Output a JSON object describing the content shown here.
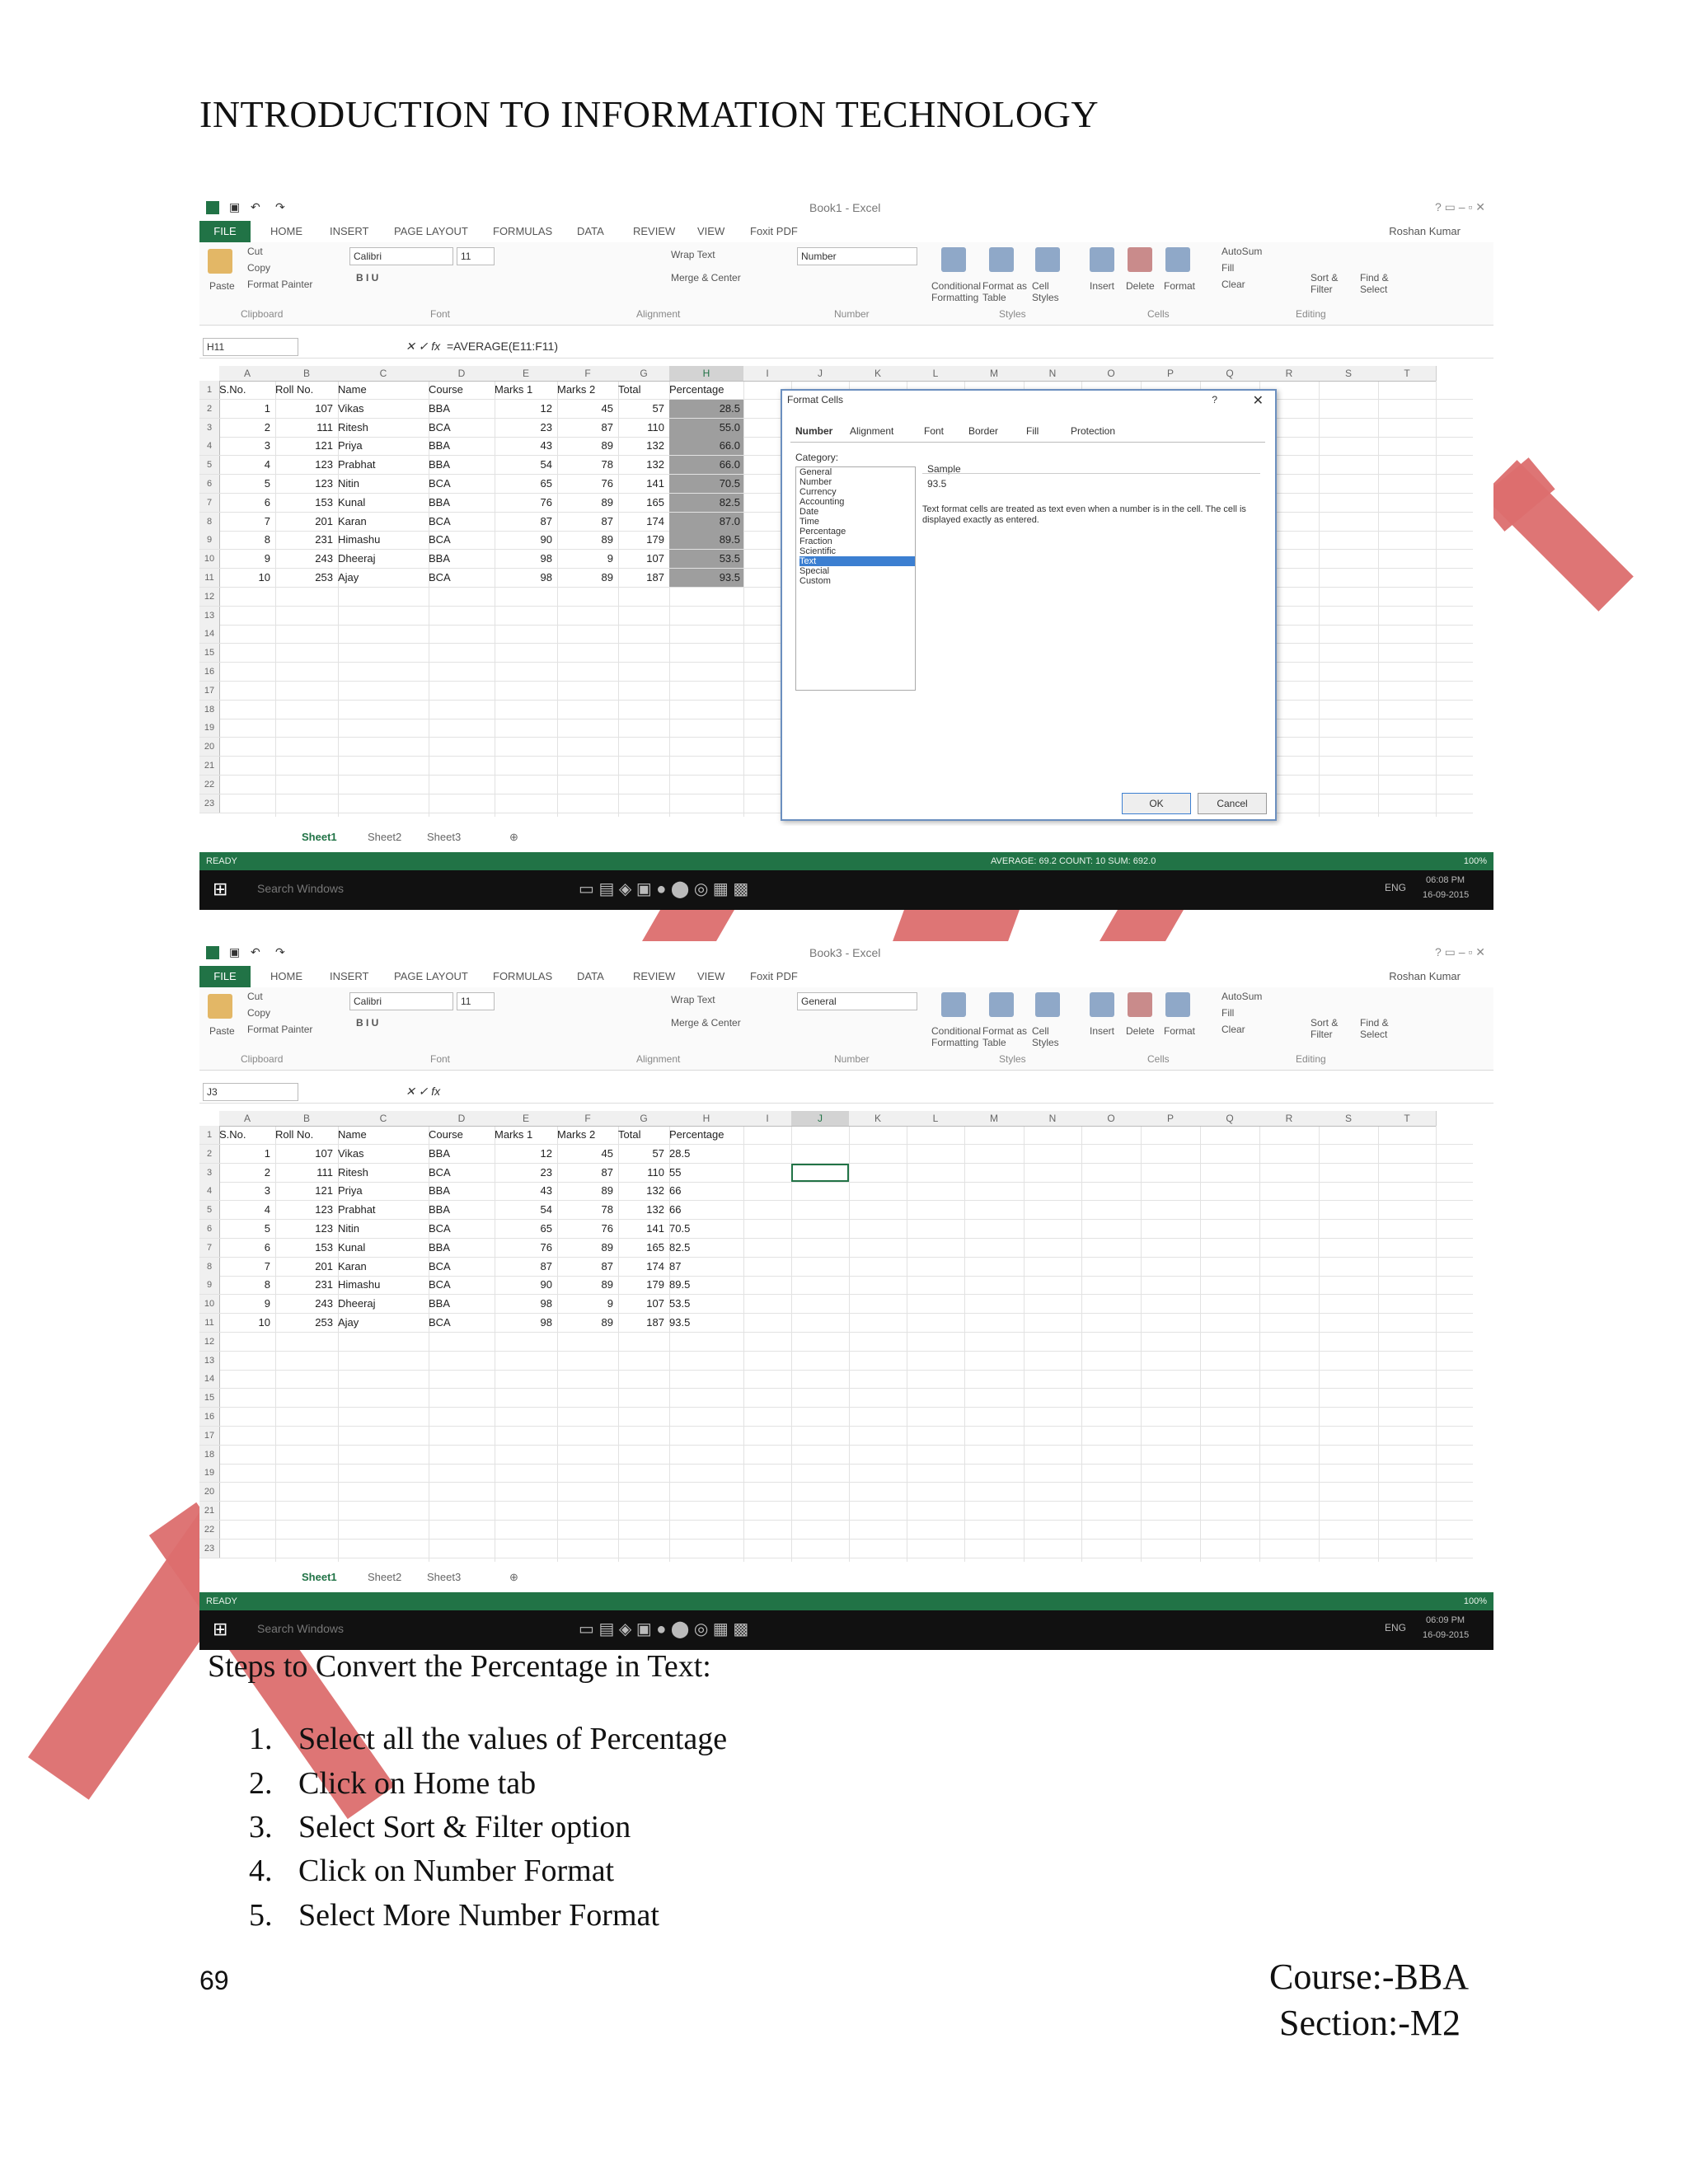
{
  "header": {
    "title": "INTRODUCTION TO INFORMATION TECHNOLOGY"
  },
  "excel": {
    "window_title_1": "Book1 - Excel",
    "window_title_2": "Book3 - Excel",
    "user": "Roshan Kumar",
    "tabs": [
      "FILE",
      "HOME",
      "INSERT",
      "PAGE LAYOUT",
      "FORMULAS",
      "DATA",
      "REVIEW",
      "VIEW",
      "Foxit PDF"
    ],
    "ribbon": {
      "cut": "Cut",
      "copy": "Copy",
      "format_painter": "Format Painter",
      "paste": "Paste",
      "font_name": "Calibri",
      "font_size": "11",
      "wrap_text": "Wrap Text",
      "merge_center": "Merge & Center",
      "number_format_1": "Number",
      "number_format_2": "General",
      "conditional_formatting": "Conditional Formatting",
      "format_as_table": "Format as Table",
      "cell_styles": "Cell Styles",
      "insert": "Insert",
      "delete": "Delete",
      "format": "Format",
      "autosum": "AutoSum",
      "fill": "Fill",
      "clear": "Clear",
      "sort_filter": "Sort & Filter",
      "find_select": "Find & Select",
      "groups": [
        "Clipboard",
        "Font",
        "Alignment",
        "Number",
        "Styles",
        "Cells",
        "Editing"
      ]
    },
    "name_box_1": "H11",
    "formula_1": "=AVERAGE(E11:F11)",
    "name_box_2": "J3",
    "formula_2": "",
    "columns": [
      "A",
      "B",
      "C",
      "D",
      "E",
      "F",
      "G",
      "H",
      "I",
      "J",
      "K",
      "L",
      "M",
      "N",
      "O",
      "P",
      "Q",
      "R",
      "S",
      "T"
    ],
    "table_headers": [
      "S.No.",
      "Roll No.",
      "Name",
      "Course",
      "Marks 1",
      "Marks 2",
      "Total",
      "Percentage"
    ],
    "table_rows": [
      [
        "1",
        "107",
        "Vikas",
        "BBA",
        "12",
        "45",
        "57",
        "28.5"
      ],
      [
        "2",
        "111",
        "Ritesh",
        "BCA",
        "23",
        "87",
        "110",
        "55"
      ],
      [
        "3",
        "121",
        "Priya",
        "BBA",
        "43",
        "89",
        "132",
        "66"
      ],
      [
        "4",
        "123",
        "Prabhat",
        "BBA",
        "54",
        "78",
        "132",
        "66"
      ],
      [
        "5",
        "123",
        "Nitin",
        "BCA",
        "65",
        "76",
        "141",
        "70.5"
      ],
      [
        "6",
        "153",
        "Kunal",
        "BBA",
        "76",
        "89",
        "165",
        "82.5"
      ],
      [
        "7",
        "201",
        "Karan",
        "BCA",
        "87",
        "87",
        "174",
        "87"
      ],
      [
        "8",
        "231",
        "Himashu",
        "BCA",
        "90",
        "89",
        "179",
        "89.5"
      ],
      [
        "9",
        "243",
        "Dheeraj",
        "BBA",
        "98",
        "9",
        "107",
        "53.5"
      ],
      [
        "10",
        "253",
        "Ajay",
        "BCA",
        "98",
        "89",
        "187",
        "93.5"
      ]
    ],
    "percentage_display_1": [
      "28.5",
      "55.0",
      "66.0",
      "66.0",
      "70.5",
      "82.5",
      "87.0",
      "89.5",
      "53.5",
      "93.5"
    ],
    "row_numbers": [
      "1",
      "2",
      "3",
      "4",
      "5",
      "6",
      "7",
      "8",
      "9",
      "10",
      "11",
      "12",
      "13",
      "14",
      "15",
      "16",
      "17",
      "18",
      "19",
      "20",
      "21",
      "22",
      "23"
    ],
    "sheets": [
      "Sheet1",
      "Sheet2",
      "Sheet3"
    ],
    "status_ready": "READY",
    "status_stats": "AVERAGE: 69.2    COUNT: 10    SUM: 692.0",
    "zoom": "100%",
    "taskbar_search": "Search Windows",
    "taskbar_lang": "ENG",
    "time_1": "06:08 PM",
    "date_1": "16-09-2015",
    "time_2": "06:09 PM",
    "date_2": "16-09-2015"
  },
  "dialog": {
    "title": "Format Cells",
    "tabs": [
      "Number",
      "Alignment",
      "Font",
      "Border",
      "Fill",
      "Protection"
    ],
    "category_label": "Category:",
    "categories": [
      "General",
      "Number",
      "Currency",
      "Accounting",
      "Date",
      "Time",
      "Percentage",
      "Fraction",
      "Scientific",
      "Text",
      "Special",
      "Custom"
    ],
    "selected_category": "Text",
    "sample_label": "Sample",
    "sample_value": "93.5",
    "description": "Text format cells are treated as text even when a number is in the cell. The cell is displayed exactly as entered.",
    "ok": "OK",
    "cancel": "Cancel",
    "help": "?",
    "close": "✕"
  },
  "steps": {
    "heading": "Steps to Convert the Percentage in Text:",
    "items": [
      {
        "num": "1.",
        "text": "Select all the values of Percentage"
      },
      {
        "num": "2.",
        "text": "Click on Home tab"
      },
      {
        "num": "3.",
        "text": "Select Sort & Filter option"
      },
      {
        "num": "4.",
        "text": "Click on Number Format"
      },
      {
        "num": "5.",
        "text": "Select More Number Format"
      }
    ]
  },
  "footer": {
    "page_number": "69",
    "course": "Course:-BBA",
    "section": "Section:-M2"
  },
  "colors": {
    "excel_green": "#217346",
    "watermark": "#dc6e6e",
    "selection": "#9e9e9e"
  }
}
